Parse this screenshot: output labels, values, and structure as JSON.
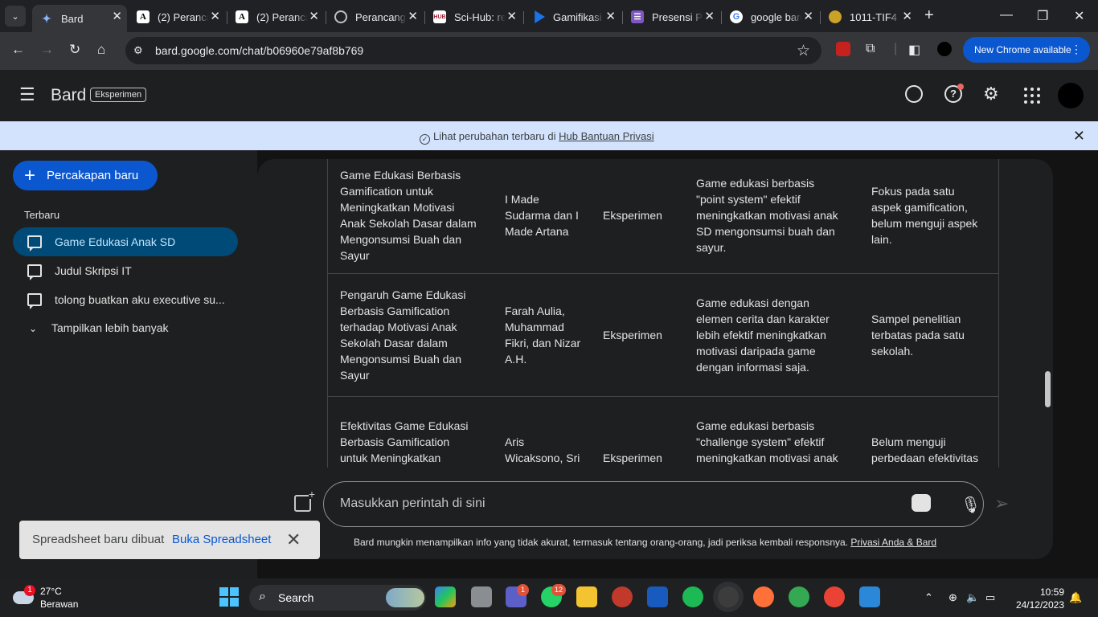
{
  "browser": {
    "tabs": [
      {
        "title": "Bard",
        "favicon": "bard-icon",
        "active": true
      },
      {
        "title": "(2) Perancangan",
        "favicon": "academia-icon"
      },
      {
        "title": "(2) Perancangan",
        "favicon": "academia-icon"
      },
      {
        "title": "Perancangan",
        "favicon": "globe-icon"
      },
      {
        "title": "Sci-Hub: removing",
        "favicon": "scihub-icon"
      },
      {
        "title": "Gamifikasi",
        "favicon": "gamifikasi-icon"
      },
      {
        "title": "Presensi Perkuliahan",
        "favicon": "forms-icon"
      },
      {
        "title": "google bard",
        "favicon": "google-icon"
      },
      {
        "title": "1011-TIF4",
        "favicon": "campus-icon"
      }
    ],
    "url": "bard.google.com/chat/b06960e79af8b769",
    "new_chrome_label": "New Chrome available"
  },
  "app": {
    "name": "Bard",
    "badge": "Eksperimen"
  },
  "banner": {
    "text": "Lihat perubahan terbaru di",
    "link": "Hub Bantuan Privasi"
  },
  "sidebar": {
    "new_chat": "Percakapan baru",
    "recent_label": "Terbaru",
    "conversations": [
      {
        "label": "Game Edukasi Anak SD",
        "active": true
      },
      {
        "label": "Judul Skripsi IT"
      },
      {
        "label": "tolong buatkan aku executive su..."
      }
    ],
    "show_more": "Tampilkan lebih banyak"
  },
  "table": {
    "rows": [
      {
        "title": "Game Edukasi Berbasis Gamification untuk Meningkatkan Motivasi Anak Sekolah Dasar dalam Mengonsumsi Buah dan Sayur",
        "authors": "I Made Sudarma dan I Made Artana",
        "method": "Eksperimen",
        "finding": "Game edukasi berbasis \"point system\" efektif meningkatkan motivasi anak SD mengonsumsi buah dan sayur.",
        "limitation": "Fokus pada satu aspek gamification, belum menguji aspek lain."
      },
      {
        "title": "Pengaruh Game Edukasi Berbasis Gamification terhadap Motivasi Anak Sekolah Dasar dalam Mengonsumsi Buah dan Sayur",
        "authors": "Farah Aulia, Muhammad Fikri, dan Nizar A.H.",
        "method": "Eksperimen",
        "finding": "Game edukasi dengan elemen cerita dan karakter lebih efektif meningkatkan motivasi daripada game dengan informasi saja.",
        "limitation": "Sampel penelitian terbatas pada satu sekolah."
      },
      {
        "title": "Efektivitas Game Edukasi Berbasis Gamification untuk Meningkatkan Motivasi Anak Sekolah Dasar",
        "authors": "Aris Wicaksono, Sri Winarni, dan",
        "method": "Eksperimen",
        "finding": "Game edukasi berbasis \"challenge system\" efektif meningkatkan motivasi anak SD mengonsumsi buah dan sayur.",
        "limitation": "Belum menguji perbedaan efektivitas terhadap anak"
      }
    ]
  },
  "input": {
    "placeholder": "Masukkan perintah di sini"
  },
  "disclaimer": {
    "text": "Bard mungkin menampilkan info yang tidak akurat, termasuk tentang orang-orang, jadi periksa kembali responsnya.",
    "link": "Privasi Anda & Bard"
  },
  "snackbar": {
    "text": "Spreadsheet baru dibuat",
    "action": "Buka Spreadsheet"
  },
  "taskbar": {
    "weather_badge": "1",
    "temperature": "27°C",
    "weather_desc": "Berawan",
    "search_label": "Search",
    "teams_badge": "1",
    "whatsapp_badge": "12",
    "time": "10:59",
    "date": "24/12/2023"
  },
  "colors": {
    "accent": "#0b57d0",
    "active_conversation": "#004a77",
    "banner": "#d3e3fd",
    "panel": "#1e1f20"
  }
}
